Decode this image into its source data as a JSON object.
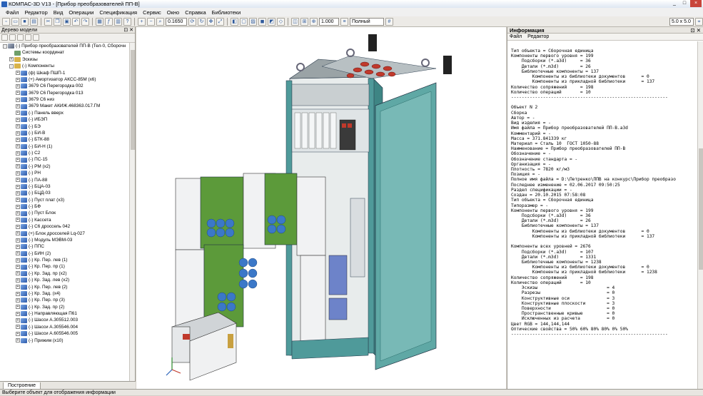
{
  "window": {
    "title": "КОМПАС-3D V13 - [Прибор преобразователей ПП-В]",
    "buttons": [
      "_",
      "□",
      "×"
    ]
  },
  "menu": [
    {
      "label": "Файл"
    },
    {
      "label": "Редактор"
    },
    {
      "label": "Вид"
    },
    {
      "label": "Операции"
    },
    {
      "label": "Спецификация"
    },
    {
      "label": "Сервис"
    },
    {
      "label": "Окно"
    },
    {
      "label": "Справка"
    },
    {
      "label": "Библиотеки"
    }
  ],
  "toolbar": {
    "zoom_value": "0.1650",
    "scale_value": "1.000",
    "mode_value": "Полный",
    "grid_value": "5.0 x 5.0"
  },
  "tree": {
    "header": "Дерево модели",
    "tab": "Построение",
    "items": [
      {
        "label": "(-) Прибор преобразователей ПП-В (Тел-0, Сборочн",
        "icon": "asm",
        "level": 0,
        "exp": "-"
      },
      {
        "label": "Системы координат",
        "icon": "sys",
        "level": 1,
        "exp": ""
      },
      {
        "label": "Эскизы",
        "icon": "folder",
        "level": 1,
        "exp": "+"
      },
      {
        "label": "(-) Компоненты",
        "icon": "folder",
        "level": 1,
        "exp": "-"
      },
      {
        "label": "(ф) Шкаф ПШП-1",
        "icon": "part",
        "level": 2,
        "exp": "+"
      },
      {
        "label": "(+) Амортизатор АКСС-85М (х6)",
        "icon": "part",
        "level": 2,
        "exp": "+"
      },
      {
        "label": "3679 С6 Перегородка 002",
        "icon": "part",
        "level": 2,
        "exp": "+"
      },
      {
        "label": "3679 С6 Перегородка 013",
        "icon": "part",
        "level": 2,
        "exp": "+"
      },
      {
        "label": "3679 С6 низ",
        "icon": "part",
        "level": 2,
        "exp": "+"
      },
      {
        "label": "3679 Макет АКИЖ.468363.017.ГМ",
        "icon": "part",
        "level": 2,
        "exp": "+"
      },
      {
        "label": "(-) Панель вверх",
        "icon": "part",
        "level": 2,
        "exp": "+"
      },
      {
        "label": "(-) ИБЭП",
        "icon": "part",
        "level": 2,
        "exp": "+"
      },
      {
        "label": "(-) БЭ",
        "icon": "part",
        "level": 2,
        "exp": "+"
      },
      {
        "label": "(-) БИ-В",
        "icon": "part",
        "level": 2,
        "exp": "+"
      },
      {
        "label": "(-) БТК-88",
        "icon": "part",
        "level": 2,
        "exp": "+"
      },
      {
        "label": "(-) БИ-Н (1)",
        "icon": "part",
        "level": 2,
        "exp": "+"
      },
      {
        "label": "(-) С2",
        "icon": "part",
        "level": 2,
        "exp": "+"
      },
      {
        "label": "(-) ПС-15",
        "icon": "part",
        "level": 2,
        "exp": "+"
      },
      {
        "label": "(-) РМ (х2)",
        "icon": "part",
        "level": 2,
        "exp": "+"
      },
      {
        "label": "(-) РН",
        "icon": "part",
        "level": 2,
        "exp": "+"
      },
      {
        "label": "(-) ПА-88",
        "icon": "part",
        "level": 2,
        "exp": "+"
      },
      {
        "label": "(-) БЦА-03",
        "icon": "part",
        "level": 2,
        "exp": "+"
      },
      {
        "label": "(-) БЦД-03",
        "icon": "part",
        "level": 2,
        "exp": "+"
      },
      {
        "label": "(-) Пуст плат (х3)",
        "icon": "part",
        "level": 2,
        "exp": "+"
      },
      {
        "label": "(-) БФ",
        "icon": "part",
        "level": 2,
        "exp": "+"
      },
      {
        "label": "(-) Пуст Блок",
        "icon": "part",
        "level": 2,
        "exp": "+"
      },
      {
        "label": "(-) Кассета",
        "icon": "part",
        "level": 2,
        "exp": "+"
      },
      {
        "label": "(-) С6 дроссель 042",
        "icon": "part",
        "level": 2,
        "exp": "+"
      },
      {
        "label": "(+) Блок дросселей Lq-027",
        "icon": "part",
        "level": 2,
        "exp": "+"
      },
      {
        "label": "(-) Модуль МЭВМ-03",
        "icon": "part",
        "level": 2,
        "exp": "+"
      },
      {
        "label": "(-) ППС",
        "icon": "part",
        "level": 2,
        "exp": "+"
      },
      {
        "label": "(-) БИН (2)",
        "icon": "part",
        "level": 2,
        "exp": "+"
      },
      {
        "label": "(-) Кр. Пер. лев (1)",
        "icon": "part",
        "level": 2,
        "exp": "+"
      },
      {
        "label": "(-) Кр. Пер. пр (1)",
        "icon": "part",
        "level": 2,
        "exp": "+"
      },
      {
        "label": "(-) Кр. Зад. пр (х2)",
        "icon": "part",
        "level": 2,
        "exp": "+"
      },
      {
        "label": "(-) Кр. Зад. лев (х2)",
        "icon": "part",
        "level": 2,
        "exp": "+"
      },
      {
        "label": "(-) Кр. Пер. лев (2)",
        "icon": "part",
        "level": 2,
        "exp": "+"
      },
      {
        "label": "(-) Кр. Зад. (х4)",
        "icon": "part",
        "level": 2,
        "exp": "+"
      },
      {
        "label": "(-) Кр. Пер. пр (3)",
        "icon": "part",
        "level": 2,
        "exp": "+"
      },
      {
        "label": "(-) Кр. Зад. пр (2)",
        "icon": "part",
        "level": 2,
        "exp": "+"
      },
      {
        "label": "(-) Направляющая П61",
        "icon": "part",
        "level": 2,
        "exp": "+"
      },
      {
        "label": "(-) Шасси А.305512.003",
        "icon": "part",
        "level": 2,
        "exp": "+"
      },
      {
        "label": "(-) Шасси А.305546.004",
        "icon": "part",
        "level": 2,
        "exp": "+"
      },
      {
        "label": "(-) Шасси А.605546.005",
        "icon": "part",
        "level": 2,
        "exp": "+"
      },
      {
        "label": "(-) Прижим (х10)",
        "icon": "part",
        "level": 2,
        "exp": "+"
      }
    ]
  },
  "info": {
    "header": "Информация",
    "menu": [
      "Файл",
      "Редактор"
    ],
    "lines": [
      "Тип объекта = Сборочная единица",
      "Компоненты первого уровня = 199",
      "    Подсборки (*.a3d)     = 36",
      "    Детали (*.m3d)        = 26",
      "    Библиотечные компоненты = 137",
      "        Компоненты из библиотеки документов      = 0",
      "        Компоненты из прикладной библиотеки      = 137",
      "Количество сопряжений     = 198",
      "Количество операций       = 10",
      "-----------------------------------------------------------",
      "",
      "Объект N 2",
      "Сборка",
      "Автор = -",
      "Вид изделия = -",
      "Имя файла = Прибор преобразователей ПП-В.a3d",
      "Комментарий = -",
      "Масса = 371.841339 кг",
      "Материал = Сталь 10  ГОСТ 1050-88",
      "Наименование = Прибор преобразователей ПП-В",
      "Обозначение = -",
      "Обозначение стандарта = -",
      "Организация = -",
      "Плотность = 7820 кг/м3",
      "Позиция = -",
      "Полное имя файла = D:\\Петренко\\ППВ на конкурс\\Прибор преобразо",
      "Последнее изменение = 02.06.2017 09:50:25",
      "Раздел спецификации = -",
      "Создан = 20.10.2015 07:58:08",
      "Тип объекта = Сборочная единица",
      "Типоразмер = -",
      "Компоненты первого уровня = 199",
      "    Подсборки (*.a3d)     = 36",
      "    Детали (*.m3d)        = 26",
      "    Библиотечные компоненты = 137",
      "        Компоненты из библиотеки документов      = 0",
      "        Компоненты из прикладной библиотеки      = 137",
      "",
      "Компоненты всех уровней = 2676",
      "    Подсборки (*.a3d)     = 107",
      "    Детали (*.m3d)        = 1331",
      "    Библиотечные компоненты = 1238",
      "        Компоненты из библиотеки документов      = 0",
      "        Компоненты из прикладной библиотеки      = 1238",
      "Количество сопряжений     = 198",
      "Количество операций       = 10",
      "    Эскизы                          = 4",
      "    Разрезы                         = 0",
      "    Конструктивные оси              = 3",
      "    Конструктивные плоскости        = 3",
      "    Поверхности                     = 0",
      "    Пространственные кривые         = 0",
      "    Исключенных из расчета          = 0",
      "Цвет RGB = 144,144,144",
      "Оптические свойства = 50% 60% 80% 80% 0% 50%",
      "-----------------------------------------------------------"
    ]
  },
  "status": {
    "text": "Выберите объект для отображения информации"
  },
  "colors": {
    "cabinet": "#4f9a9a",
    "door": "#5fa8a5",
    "pcb": "#5c9a3a",
    "capacitor": "#3b78c8",
    "roof_buttons": "#c0392b"
  }
}
